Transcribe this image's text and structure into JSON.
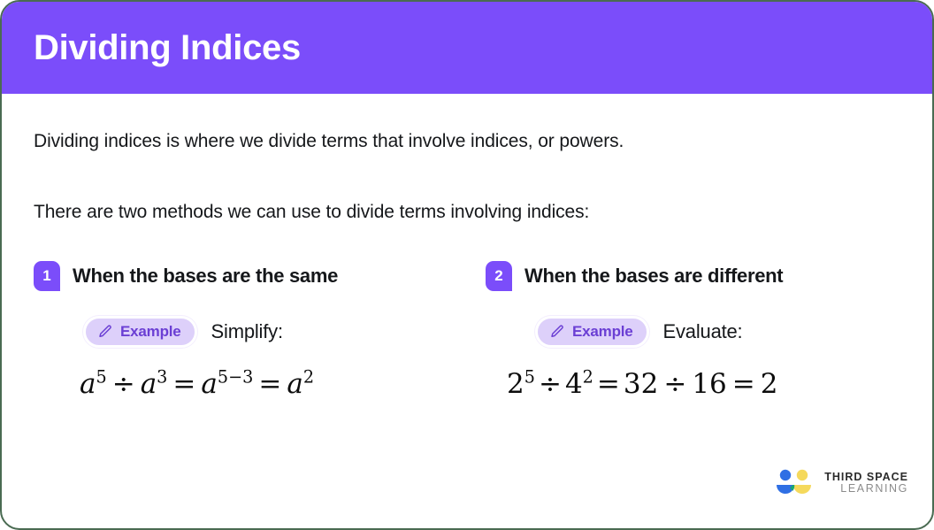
{
  "header": {
    "title": "Dividing Indices",
    "background_color": "#7b4dfa",
    "title_color": "#ffffff"
  },
  "body": {
    "intro_1": "Dividing indices is where we divide terms that involve indices, or powers.",
    "intro_2": "There are two methods we can use to divide terms involving indices:"
  },
  "methods": [
    {
      "number": "1",
      "title": "When the bases are the same",
      "example_label": "Example",
      "example_icon": "pencil-icon",
      "action": "Simplify:",
      "formula_plain": "a^5 ÷ a^3 = a^(5−3) = a^2",
      "formula_parts": {
        "base_1": "a",
        "exp_1": "5",
        "operator_1": "÷",
        "base_2": "a",
        "exp_2": "3",
        "equals_1": "=",
        "base_3": "a",
        "exp_3": "5−3",
        "equals_2": "=",
        "base_4": "a",
        "exp_4": "2"
      }
    },
    {
      "number": "2",
      "title": "When the bases are different",
      "example_label": "Example",
      "example_icon": "pencil-icon",
      "action": "Evaluate:",
      "formula_plain": "2^5 ÷ 4^2 = 32 ÷ 16 = 2",
      "formula_parts": {
        "base_1": "2",
        "exp_1": "5",
        "operator_1": "÷",
        "base_2": "4",
        "exp_2": "2",
        "equals_1": "=",
        "value_1": "32",
        "operator_2": "÷",
        "value_2": "16",
        "equals_2": "=",
        "value_3": "2"
      }
    }
  ],
  "logo": {
    "name_top": "THIRD SPACE",
    "name_bottom": "LEARNING",
    "colors": {
      "blue": "#2f6fe4",
      "blue_dot": "#2f6fe4",
      "yellow": "#f5d95c",
      "green": "#1aa574"
    }
  },
  "theme": {
    "accent_purple": "#7b4dfa",
    "pill_background": "#ddd0fa",
    "pill_text": "#6b3fd4",
    "card_border": "#4a6b52",
    "text_color": "#15171a"
  }
}
